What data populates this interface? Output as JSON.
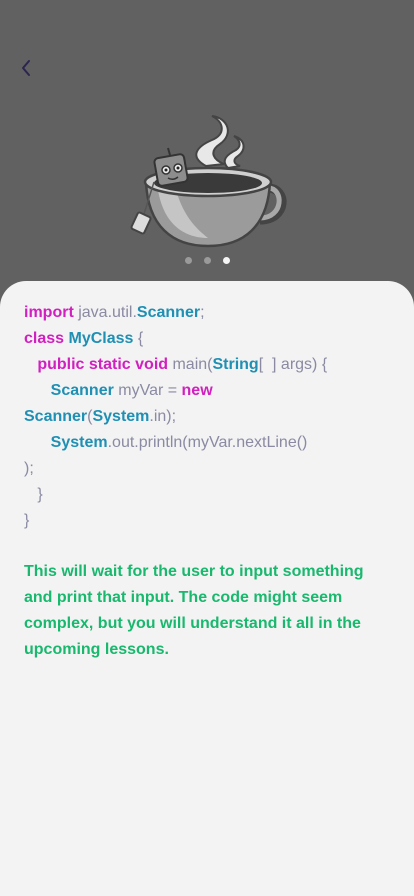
{
  "colors": {
    "header_bg": "#616161",
    "sheet_bg": "#f3f3f3",
    "keyword": "#d21fc0",
    "type": "#1f8fb3",
    "plain": "#8a8aa3",
    "description": "#19b86e",
    "back_icon": "#2b2550"
  },
  "pager": {
    "total": 3,
    "active_index": 2
  },
  "code": {
    "l1": {
      "kw": "import",
      "a": " java.util.",
      "ty": "Scanner",
      "b": ";"
    },
    "l2": {
      "kw": "class",
      "sp": " ",
      "ty": "MyClass",
      "b": " {"
    },
    "l3": {
      "indent": "   ",
      "kw": "public static void",
      "a": " main(",
      "ty": "String",
      "b": "[  ] args) {"
    },
    "l4": {
      "indent": "      ",
      "ty": "Scanner",
      "a": " myVar = ",
      "kw": "new"
    },
    "l5": {
      "ty1": "Scanner",
      "a": "(",
      "ty2": "System",
      "b": ".in);"
    },
    "l6": {
      "indent": "      ",
      "ty": "System",
      "a": ".out.println(myVar.nextLine()"
    },
    "l7": {
      "text": ");"
    },
    "l8": {
      "text": "   }"
    },
    "l9": {
      "text": "}"
    }
  },
  "description": "This will wait for the user to input something and print that input. The code might seem complex, but you will understand it all in the upcoming lessons."
}
